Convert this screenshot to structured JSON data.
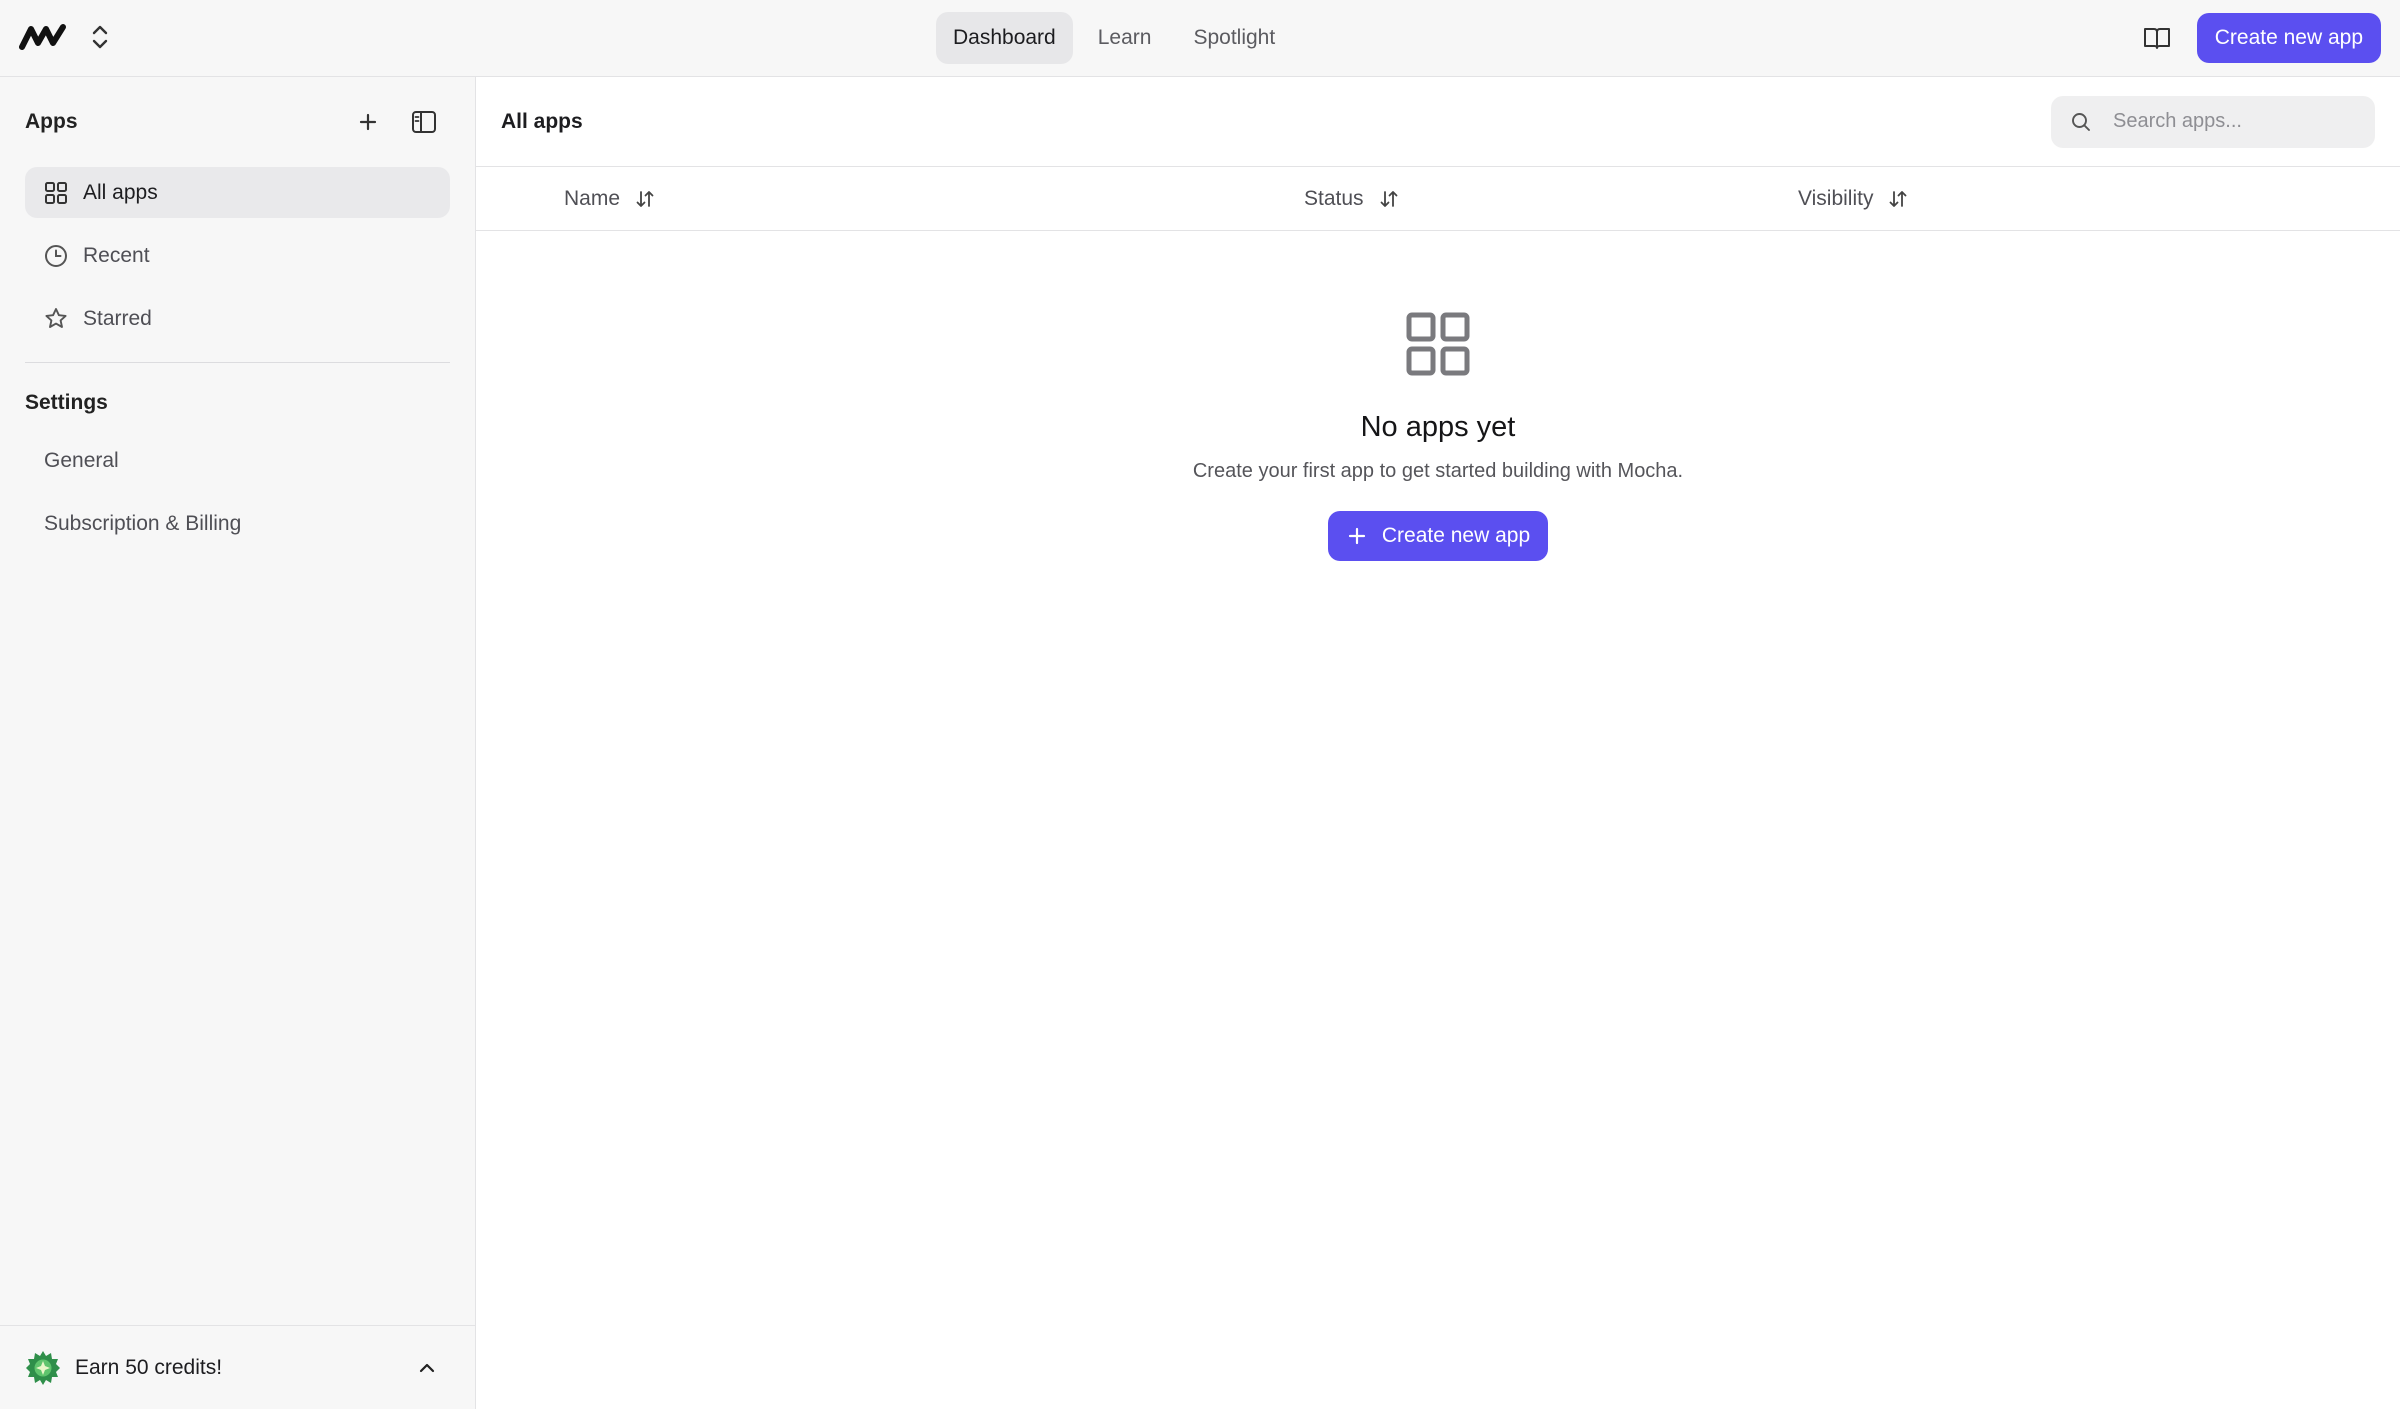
{
  "colors": {
    "accent": "#5b4ff0",
    "sidebar_bg": "#f7f7f7",
    "active_bg": "#e9e9eb"
  },
  "topbar": {
    "logo_icon": "mocha-logo-icon",
    "switcher_icon": "chevron-updown-icon",
    "tabs": [
      {
        "label": "Dashboard",
        "active": true
      },
      {
        "label": "Learn",
        "active": false
      },
      {
        "label": "Spotlight",
        "active": false
      }
    ],
    "docs_icon": "book-icon",
    "create_label": "Create new app"
  },
  "sidebar": {
    "title": "Apps",
    "items": [
      {
        "label": "All apps",
        "icon": "grid-icon",
        "active": true
      },
      {
        "label": "Recent",
        "icon": "clock-icon",
        "active": false
      },
      {
        "label": "Starred",
        "icon": "star-icon",
        "active": false
      }
    ],
    "settings_title": "Settings",
    "settings_items": [
      {
        "label": "General"
      },
      {
        "label": "Subscription & Billing"
      }
    ],
    "footer_label": "Earn 50 credits!"
  },
  "main": {
    "title": "All apps",
    "search_placeholder": "Search apps...",
    "columns": [
      {
        "label": "Name"
      },
      {
        "label": "Status"
      },
      {
        "label": "Visibility"
      }
    ],
    "empty": {
      "title": "No apps yet",
      "subtitle": "Create your first app to get started building with Mocha.",
      "button_label": "Create new app"
    }
  }
}
